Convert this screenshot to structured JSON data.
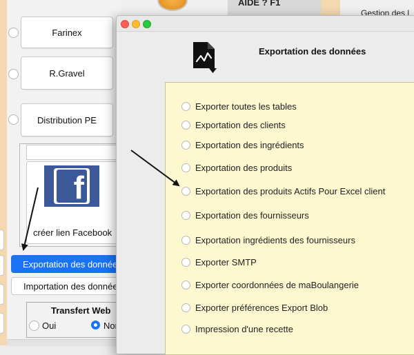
{
  "background": {
    "top_label": "AIDE ? F1",
    "top_right_label": "Gestion des l",
    "sidebar_buttons": [
      "Farinex",
      "R.Gravel",
      "Distribution PE"
    ],
    "facebook_label": "créer lien Facebook",
    "export_button": "Exportation des données",
    "import_button": "Importation des données",
    "transfer_web": {
      "title": "Transfert Web",
      "option_yes": "Oui",
      "option_no": "Non",
      "selected": "Non"
    }
  },
  "modal": {
    "title": "Exportation des données",
    "icon": "document-chart-export-icon",
    "options": [
      "Exporter toutes les tables",
      "Exportation des clients",
      "Exportation des ingrédients",
      "Exportation des produits",
      "Exportation des produits Actifs Pour Excel client",
      "Exportation des fournisseurs",
      "Exportation ingrédients des fournisseurs",
      "Exporter SMTP",
      "Exporter coordonnées de maBoulangerie",
      "Exporter préférences Export Blob",
      "Impression d'une recette"
    ]
  },
  "colors": {
    "accent": "#1a73f5",
    "panel_yellow": "#fdf8cf",
    "sidebar_beige": "#f3d8b0"
  }
}
